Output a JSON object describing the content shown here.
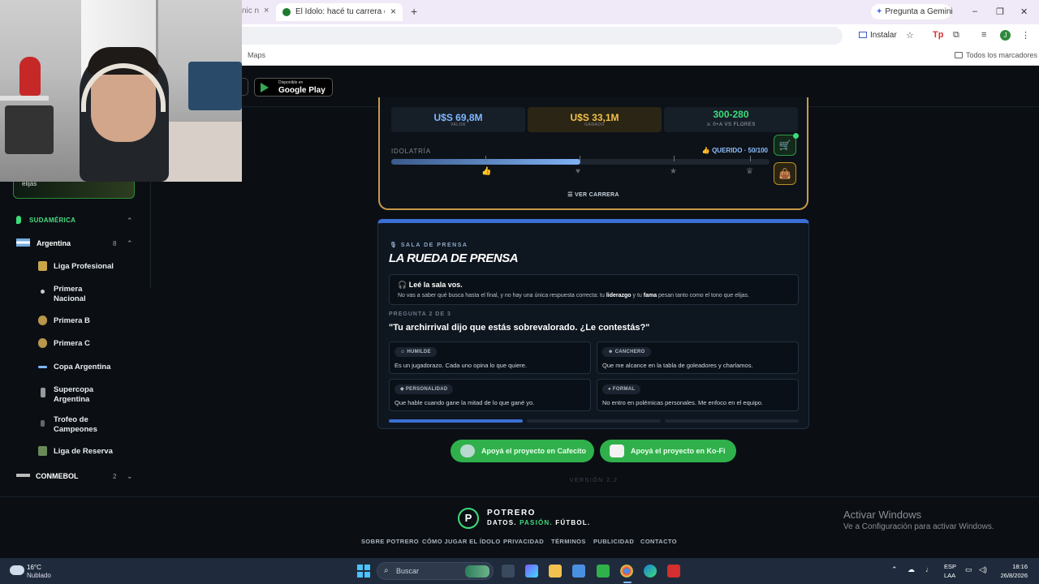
{
  "browser": {
    "prev_tab_partial": "nic n",
    "active_tab_title": "El Ídolo: hacé tu carrera de fútbol",
    "gemini_label": "Pregunta a Gemini",
    "install_label": "Instalar",
    "bookmark_maps": "Maps",
    "bookmark_all": "Todos los marcadores",
    "profile_initial": "J"
  },
  "header": {
    "gplay_small": "Disponible en",
    "gplay_big": "Google Play"
  },
  "sidebar": {
    "card_text": "elijas",
    "region": "SUDAMÉRICA",
    "country": "Argentina",
    "country_count": "8",
    "items": [
      {
        "label": "Liga Profesional"
      },
      {
        "label": "Primera Nacional"
      },
      {
        "label": "Primera B"
      },
      {
        "label": "Primera C"
      },
      {
        "label": "Copa Argentina"
      },
      {
        "label": "Supercopa Argentina"
      },
      {
        "label": "Trofeo de Campeones"
      },
      {
        "label": "Liga de Reserva"
      }
    ],
    "conmebol": "CONMEBOL",
    "conmebol_count": "2",
    "x_label": "𝕏"
  },
  "career": {
    "stats": [
      {
        "value": "U$S 69,8M",
        "label": "VALOR",
        "color": "#7fb8ff"
      },
      {
        "value": "U$S 33,1M",
        "label": "GANADO",
        "color": "#f2c14e"
      },
      {
        "value": "300-280",
        "label": "⚔ 0+A VS FLORES",
        "color": "#3ddc7a"
      }
    ],
    "idolatry_label": "IDOLATRÍA",
    "idolatry_status": "👍 QUERIDO · 50/100",
    "idolatry_progress": 0.5,
    "ver_carrera": "☰  VER CARRERA"
  },
  "press": {
    "eyebrow": "🎙 SALA DE PRENSA",
    "title": "LA RUEDA DE PRENSA",
    "info_heading": "🎧 Leé la sala vos.",
    "info_text_1": "No vas a saber qué busca hasta el final, y no hay una única respuesta correcta: tu ",
    "info_bold_1": "liderazgo",
    "info_text_2": " y tu ",
    "info_bold_2": "fama",
    "info_text_3": " pesan tanto como el tono que elijas.",
    "question_count": "PREGUNTA 2 DE 3",
    "question": "\"Tu archirrival dijo que estás sobrevalorado. ¿Le contestás?\"",
    "options": [
      {
        "tag": "☺ HUMILDE",
        "text": "Es un jugadorazo. Cada uno opina lo que quiere."
      },
      {
        "tag": "☻ CANCHERO",
        "text": "Que me alcance en la tabla de goleadores y charlamos."
      },
      {
        "tag": "◆ PERSONALIDAD",
        "text": "Que hable cuando gane la mitad de lo que gané yo."
      },
      {
        "tag": "● FORMAL",
        "text": "No entro en polémicas personales. Me enfoco en el equipo."
      }
    ],
    "progress_current": 1,
    "progress_total": 3
  },
  "support": {
    "cafecito": "Apoyá el proyecto en Cafecito",
    "kofi": "Apoyá el proyecto en Ko-Fi",
    "version": "VERSIÓN 2.2"
  },
  "footer": {
    "brand": "POTRERO",
    "tag_a": "DATOS. ",
    "tag_b": "PASIÓN.",
    "tag_c": " FÚTBOL.",
    "links": [
      "SOBRE POTRERO",
      "CÓMO JUGAR EL ÍDOLO",
      "PRIVACIDAD",
      "TÉRMINOS",
      "PUBLICIDAD",
      "CONTACTO"
    ],
    "win_activate": "Activar Windows",
    "win_activate_sub": "Ve a Configuración para activar Windows."
  },
  "taskbar": {
    "temp": "16°C",
    "condition": "Nublado",
    "search": "Buscar",
    "lang1": "ESP",
    "lang2": "LAA",
    "time": "18:16",
    "date": "26/8/2026"
  }
}
